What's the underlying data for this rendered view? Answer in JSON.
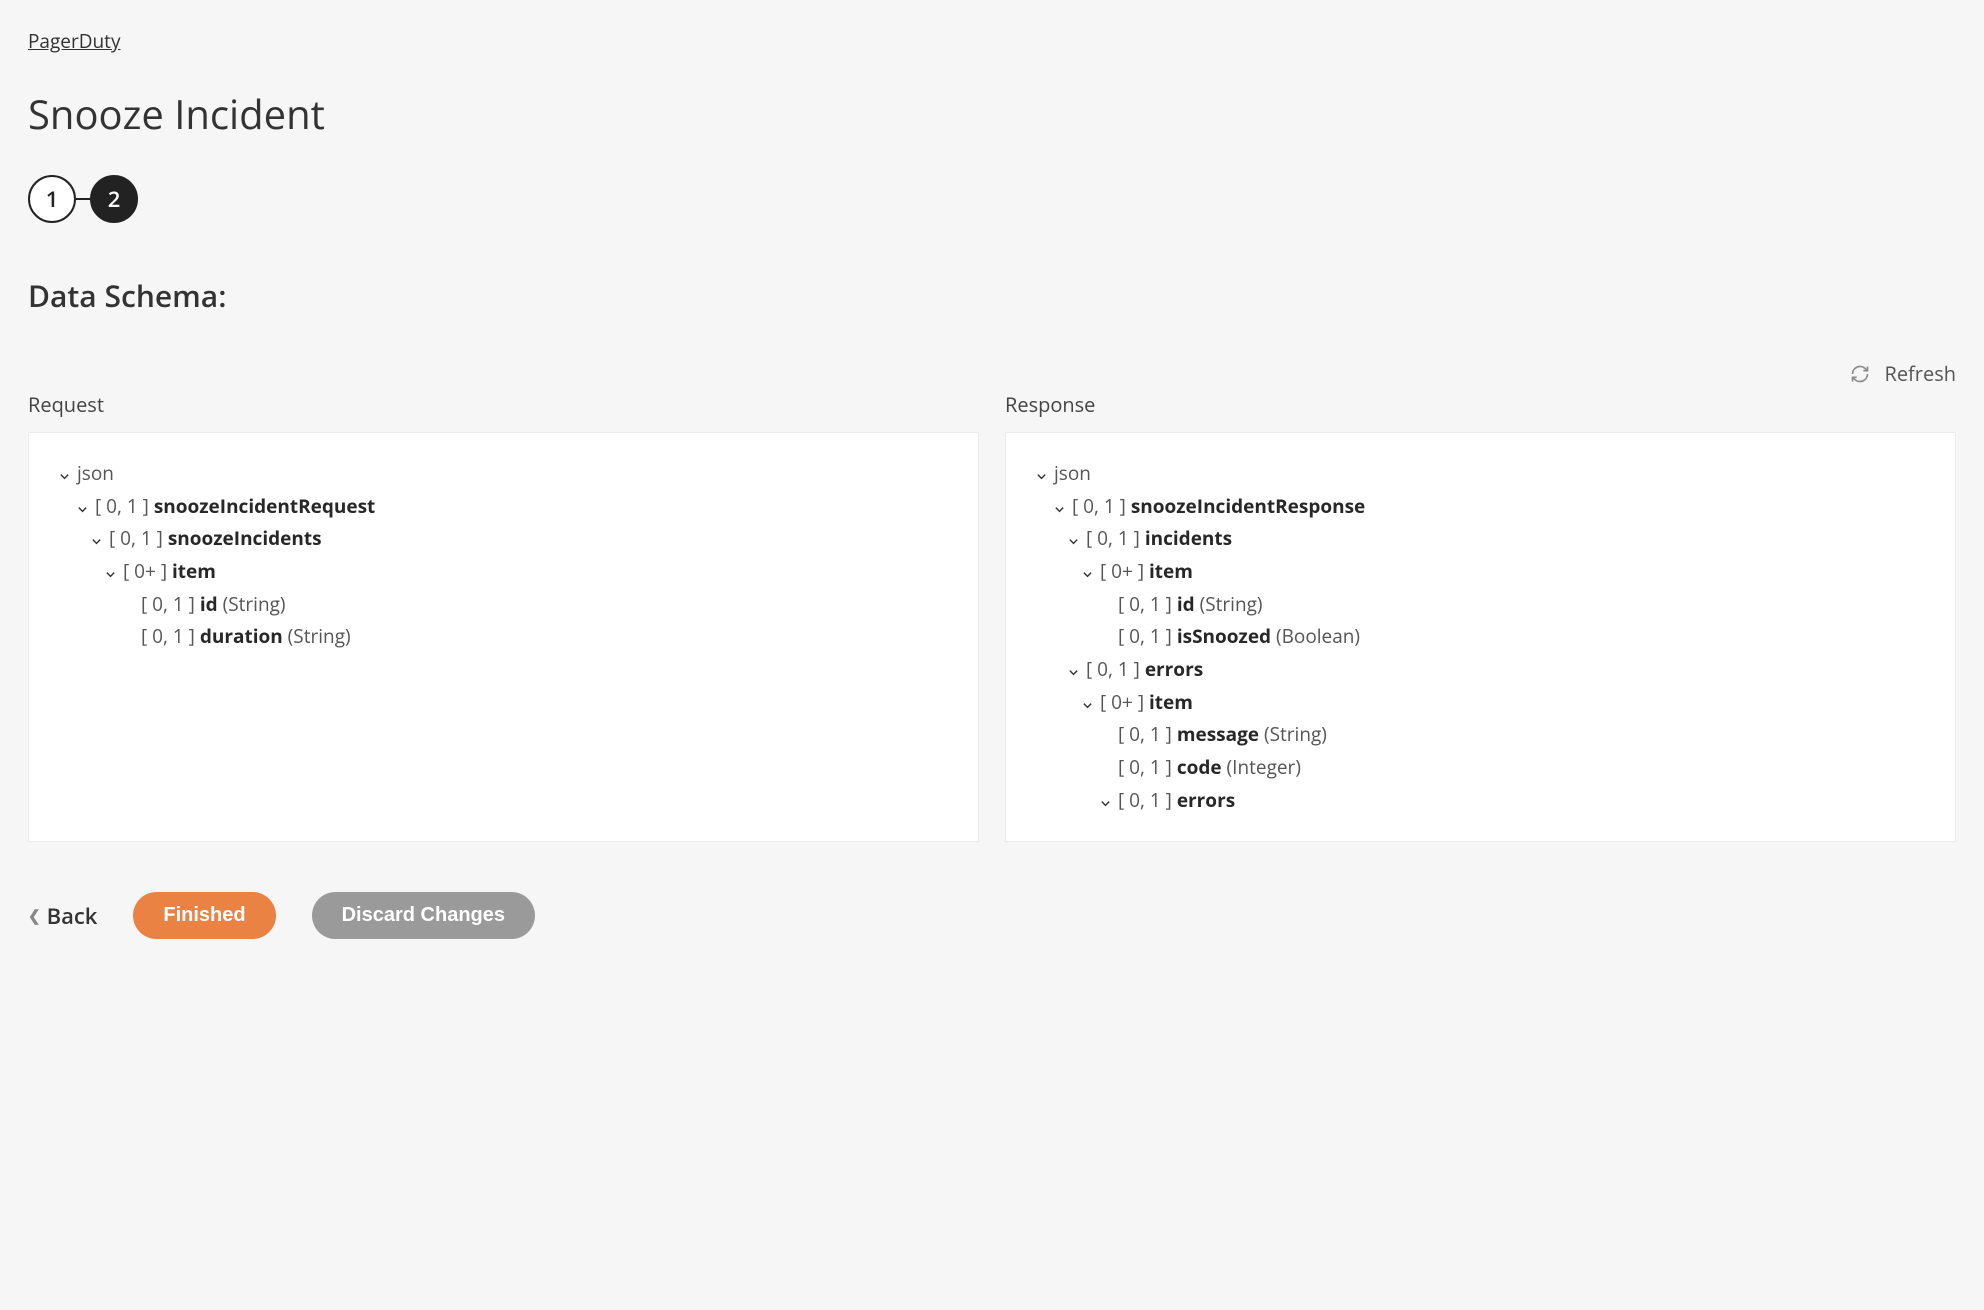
{
  "breadcrumb": "PagerDuty",
  "title": "Snooze Incident",
  "stepper": {
    "step1": "1",
    "step2": "2",
    "activeStep": 2
  },
  "section_title": "Data Schema:",
  "refresh_label": "Refresh",
  "columns": {
    "request": {
      "title": "Request",
      "tree": [
        {
          "indent": 0,
          "expandable": true,
          "cardinality": "",
          "name": "json",
          "nameBold": false,
          "type": ""
        },
        {
          "indent": 1,
          "expandable": true,
          "cardinality": "[ 0, 1 ]",
          "name": "snoozeIncidentRequest",
          "nameBold": true,
          "type": ""
        },
        {
          "indent": 2,
          "expandable": true,
          "cardinality": "[ 0, 1 ]",
          "name": "snoozeIncidents",
          "nameBold": true,
          "type": ""
        },
        {
          "indent": 3,
          "expandable": true,
          "cardinality": "[ 0+ ]",
          "name": "item",
          "nameBold": true,
          "type": ""
        },
        {
          "indent": 4,
          "expandable": false,
          "cardinality": "[ 0, 1 ]",
          "name": "id",
          "nameBold": true,
          "type": "(String)"
        },
        {
          "indent": 4,
          "expandable": false,
          "cardinality": "[ 0, 1 ]",
          "name": "duration",
          "nameBold": true,
          "type": "(String)"
        }
      ]
    },
    "response": {
      "title": "Response",
      "tree": [
        {
          "indent": 0,
          "expandable": true,
          "cardinality": "",
          "name": "json",
          "nameBold": false,
          "type": ""
        },
        {
          "indent": 1,
          "expandable": true,
          "cardinality": "[ 0, 1 ]",
          "name": "snoozeIncidentResponse",
          "nameBold": true,
          "type": ""
        },
        {
          "indent": 2,
          "expandable": true,
          "cardinality": "[ 0, 1 ]",
          "name": "incidents",
          "nameBold": true,
          "type": ""
        },
        {
          "indent": 3,
          "expandable": true,
          "cardinality": "[ 0+ ]",
          "name": "item",
          "nameBold": true,
          "type": ""
        },
        {
          "indent": 4,
          "expandable": false,
          "cardinality": "[ 0, 1 ]",
          "name": "id",
          "nameBold": true,
          "type": "(String)"
        },
        {
          "indent": 4,
          "expandable": false,
          "cardinality": "[ 0, 1 ]",
          "name": "isSnoozed",
          "nameBold": true,
          "type": "(Boolean)"
        },
        {
          "indent": 2,
          "expandable": true,
          "cardinality": "[ 0, 1 ]",
          "name": "errors",
          "nameBold": true,
          "type": ""
        },
        {
          "indent": 3,
          "expandable": true,
          "cardinality": "[ 0+ ]",
          "name": "item",
          "nameBold": true,
          "type": ""
        },
        {
          "indent": 4,
          "expandable": false,
          "cardinality": "[ 0, 1 ]",
          "name": "message",
          "nameBold": true,
          "type": "(String)"
        },
        {
          "indent": 4,
          "expandable": false,
          "cardinality": "[ 0, 1 ]",
          "name": "code",
          "nameBold": true,
          "type": "(Integer)"
        },
        {
          "indent": 4,
          "expandable": true,
          "cardinality": "[ 0, 1 ]",
          "name": "errors",
          "nameBold": true,
          "type": ""
        }
      ]
    }
  },
  "footer": {
    "back": "Back",
    "finished": "Finished",
    "discard": "Discard Changes"
  }
}
